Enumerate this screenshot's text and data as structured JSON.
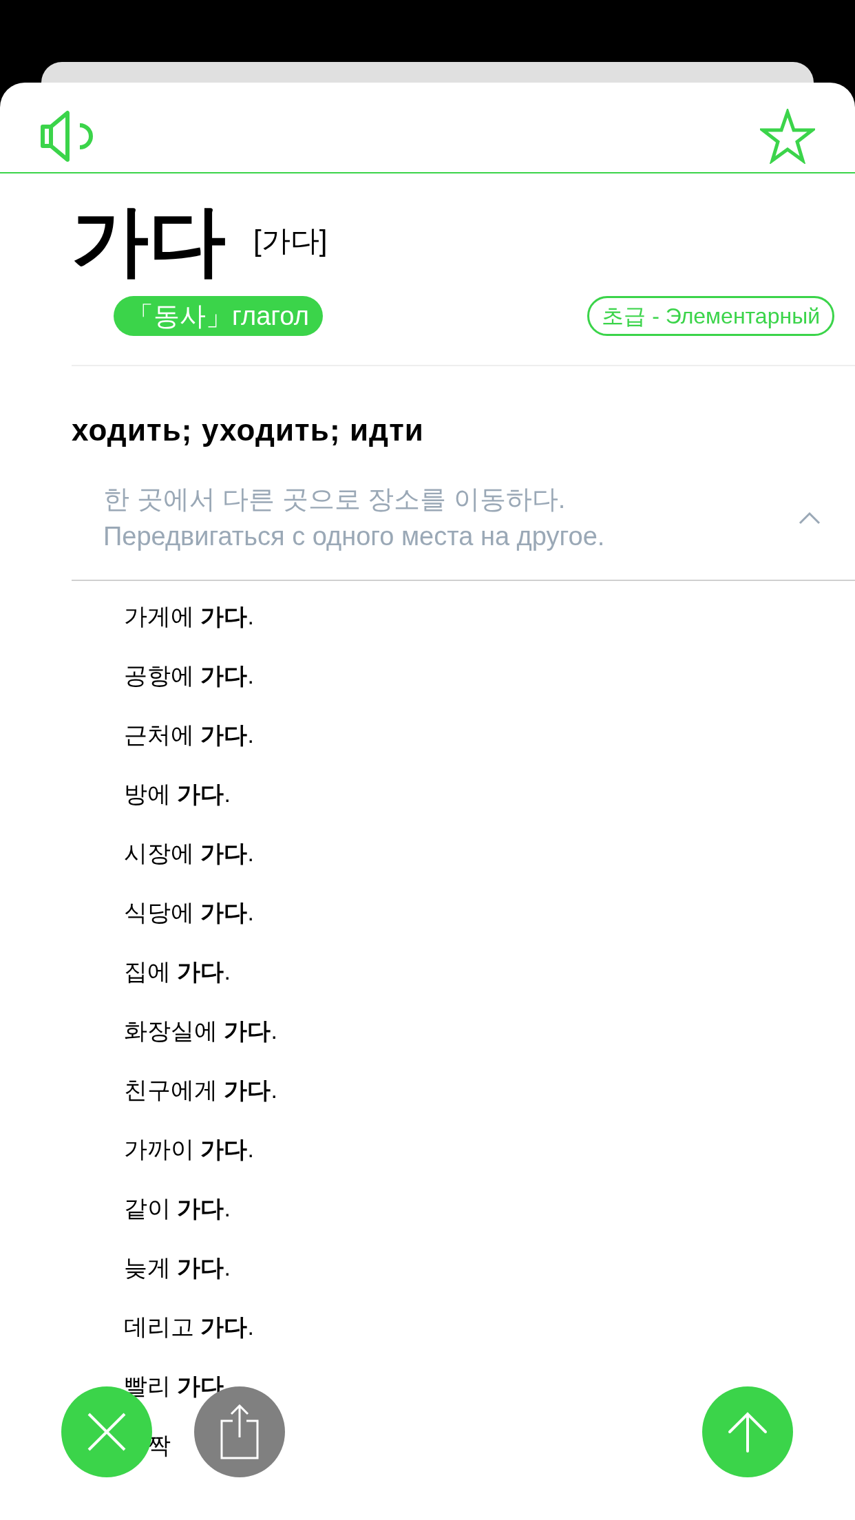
{
  "entry": {
    "word": "가다",
    "pronunciation": "[가다]",
    "part_of_speech": "「동사」глагол",
    "level": "초급 - Элементарный",
    "favorite": false
  },
  "sense": {
    "translation": "ходить; уходить; идти",
    "definition_ko": "한 곳에서 다른 곳으로 장소를 이동하다.",
    "definition_ru": "Передвигаться с одного места на другое.",
    "expanded": true
  },
  "examples": [
    "가게에 **가다**.",
    "공항에 **가다**.",
    "근처에 **가다**.",
    "방에 **가다**.",
    "시장에 **가다**.",
    "식당에 **가다**.",
    "집에 **가다**.",
    "화장실에 **가다**.",
    "친구에게 **가다**.",
    "가까이 **가다**.",
    "같이 **가다**.",
    "늦게 **가다**.",
    "데리고 **가다**.",
    "빨리 **가다**.",
    {
      "text": "짝",
      "partly_covered": true
    }
  ]
}
